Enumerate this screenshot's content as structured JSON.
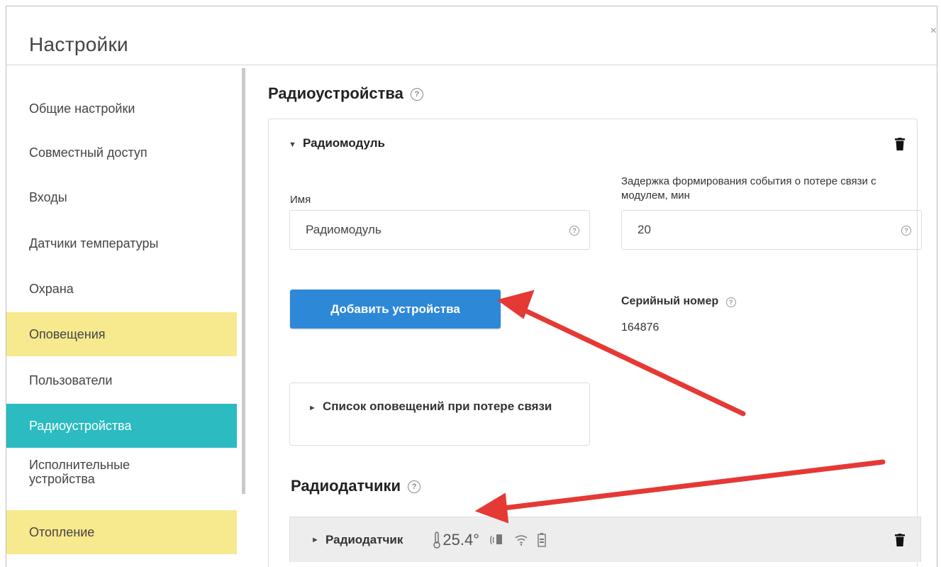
{
  "window": {
    "title": "Настройки",
    "close_glyph": "×"
  },
  "sidebar": {
    "items": [
      {
        "label": "Общие настройки",
        "state": "normal"
      },
      {
        "label": "Совместный доступ",
        "state": "normal"
      },
      {
        "label": "Входы",
        "state": "normal"
      },
      {
        "label": "Датчики температуры",
        "state": "normal"
      },
      {
        "label": "Охрана",
        "state": "normal"
      },
      {
        "label": "Оповещения",
        "state": "highlighted"
      },
      {
        "label": "Пользователи",
        "state": "normal"
      },
      {
        "label": "Радиоустройства",
        "state": "active"
      },
      {
        "label": "Исполнительные устройства",
        "state": "normal"
      },
      {
        "label": "Отопление",
        "state": "highlighted"
      }
    ]
  },
  "main": {
    "heading": "Радиоустройства",
    "module": {
      "title": "Радиомодуль",
      "name_label": "Имя",
      "name_value": "Радиомодуль",
      "delay_label": "Задержка формирования события о потере связи с модулем, мин",
      "delay_value": "20",
      "add_button": "Добавить устройства",
      "serial_label": "Серийный номер",
      "serial_value": "164876",
      "notifications_title": "Список оповещений при потере связи"
    },
    "sensors_heading": "Радиодатчики",
    "sensor": {
      "name": "Радиодатчик",
      "temperature": "25.4°"
    }
  },
  "colors": {
    "accent_teal": "#2bbbc0",
    "highlight_yellow": "#f7e98e",
    "button_blue": "#2e88d8",
    "annotation_red": "#e53935"
  },
  "icons": [
    "help-icon",
    "trash-icon",
    "caret-down-icon",
    "caret-right-icon",
    "thermometer-icon",
    "signal-icon",
    "wifi-icon",
    "battery-icon",
    "close-icon"
  ]
}
